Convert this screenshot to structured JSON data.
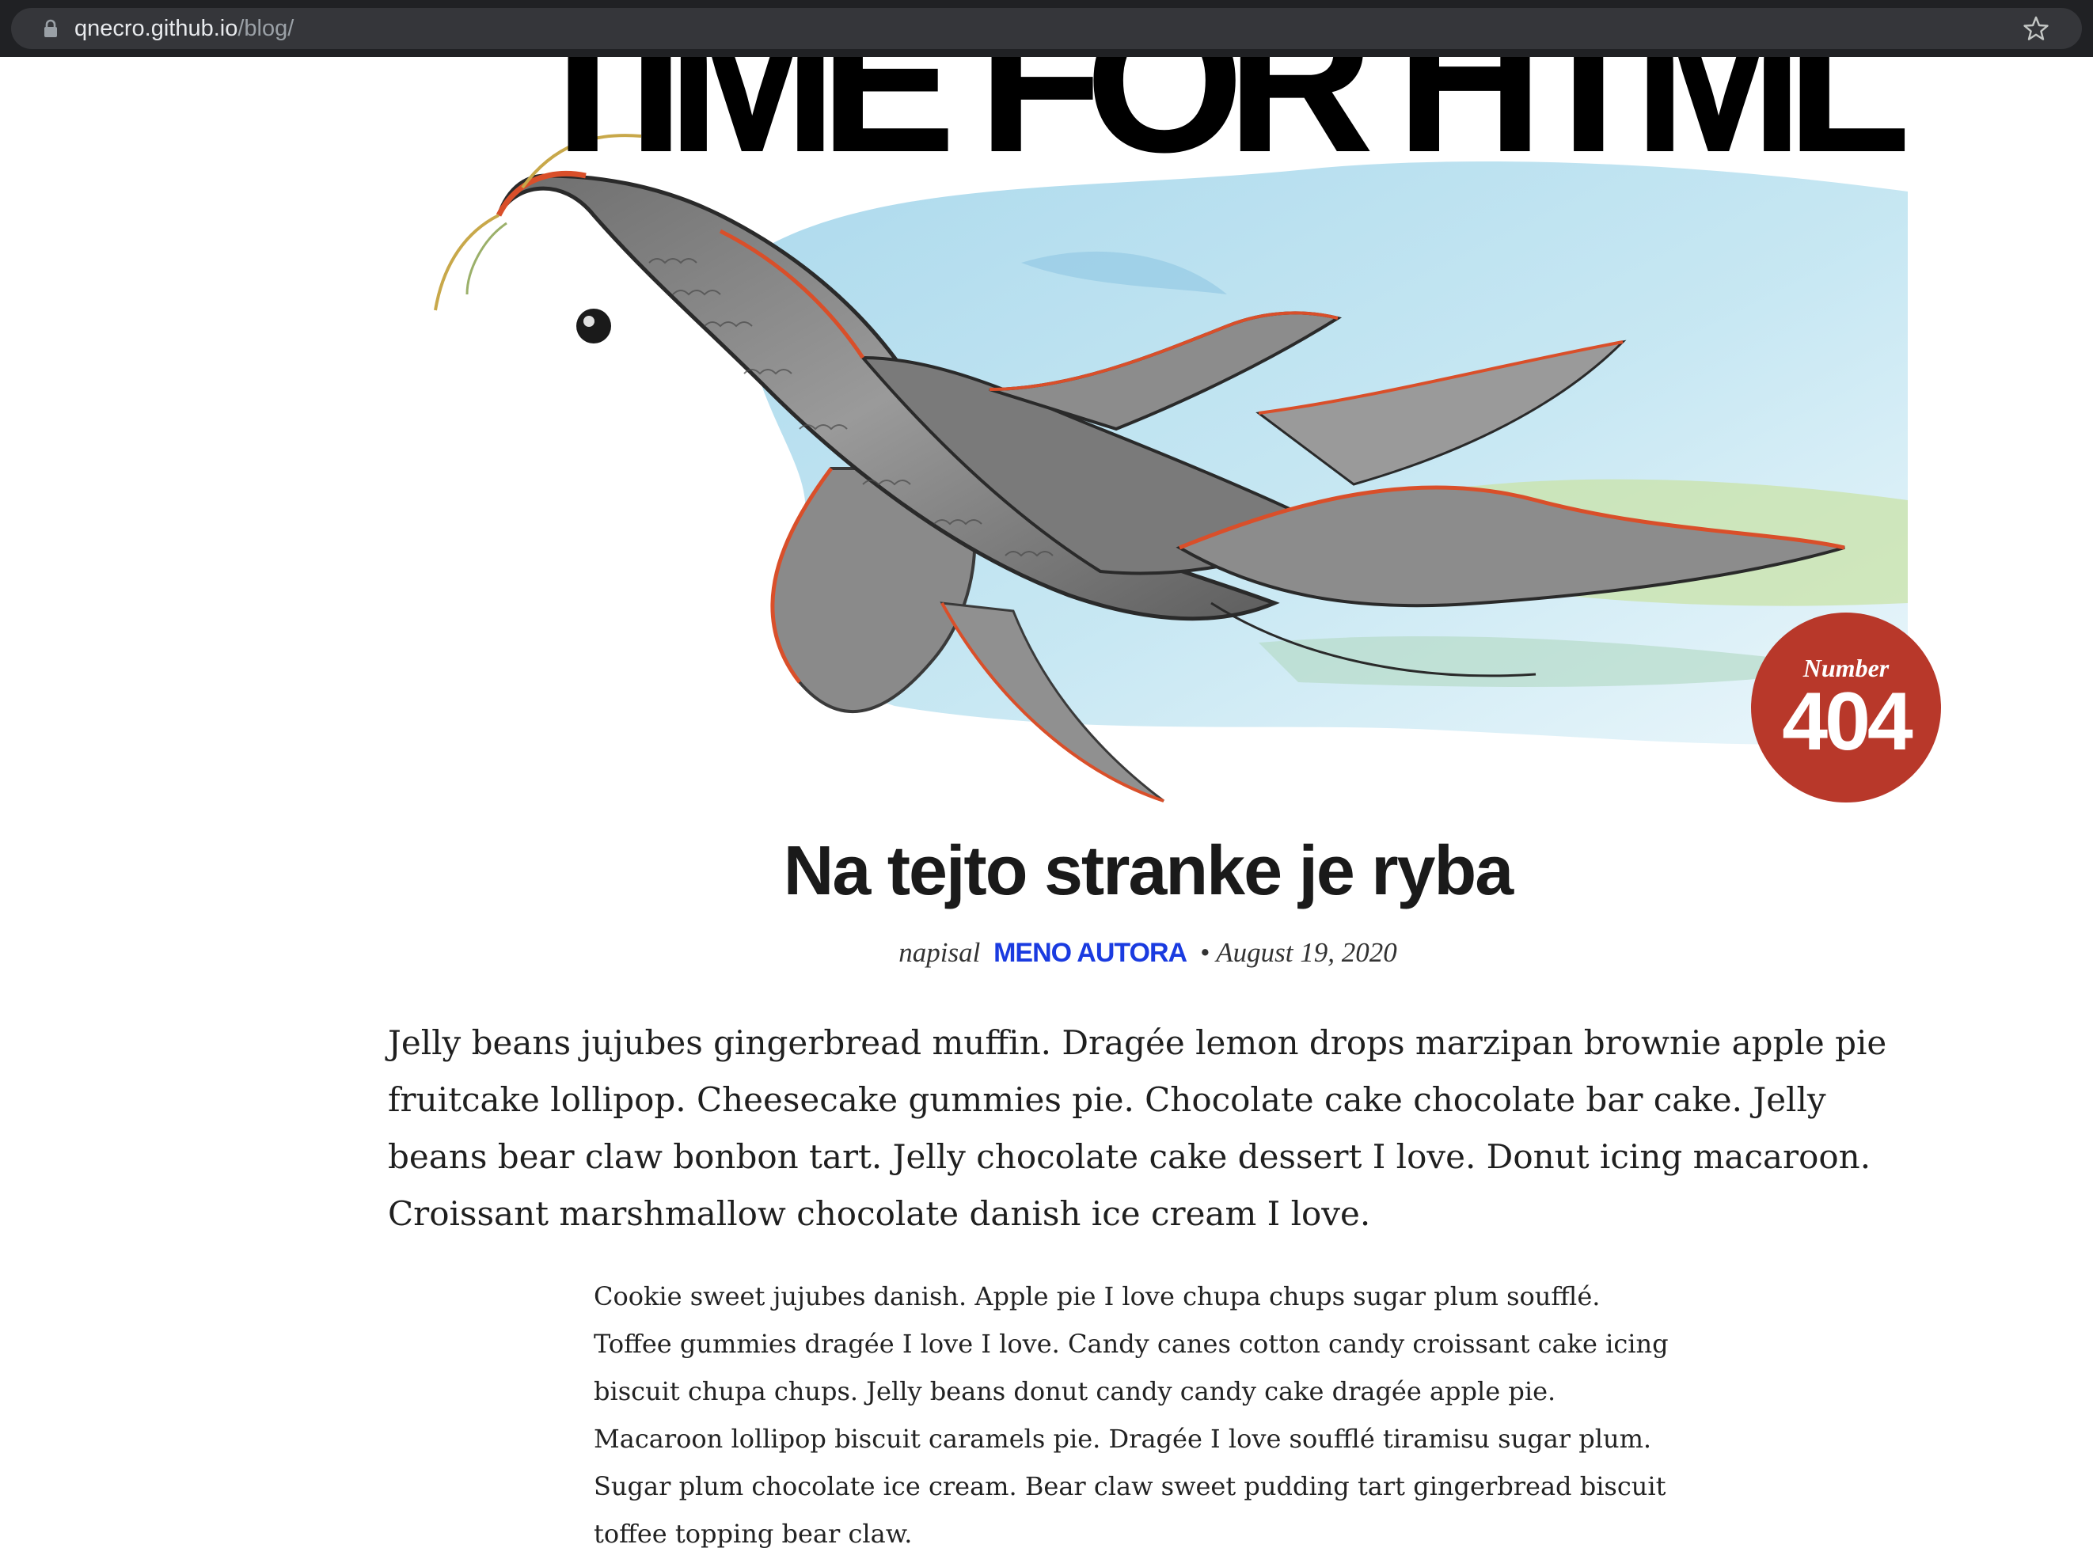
{
  "browser": {
    "url_host": "qnecro.github.io",
    "url_path": "/blog/",
    "icons": [
      "lock-icon",
      "star-icon"
    ]
  },
  "hero": {
    "title": "TIME FOR HTML",
    "illustration": "koi-fish-watercolor"
  },
  "badge": {
    "label": "Number",
    "number": "404",
    "color": "#b8382a"
  },
  "post": {
    "title": "Na tejto stranke je ryba",
    "byline_prefix": "napisal",
    "author": "MENO AUTORA",
    "separator": "•",
    "date": "August 19, 2020",
    "author_color": "#1a3be0",
    "lead": "Jelly beans jujubes gingerbread muffin. Dragée lemon drops marzipan brownie apple pie fruitcake lollipop. Cheesecake gummies pie. Chocolate cake chocolate bar cake. Jelly beans bear claw bonbon tart. Jelly chocolate cake dessert I love. Donut icing macaroon. Croissant marshmallow chocolate danish ice cream I love.",
    "body": "Cookie sweet jujubes danish. Apple pie I love chupa chups sugar plum soufflé. Toffee gummies dragée I love I love. Candy canes cotton candy croissant cake icing biscuit chupa chups. Jelly beans donut candy candy cake dragée apple pie. Macaroon lollipop biscuit caramels pie. Dragée I love soufflé tiramisu sugar plum. Sugar plum chocolate ice cream. Bear claw sweet pudding tart gingerbread biscuit toffee topping bear claw."
  }
}
